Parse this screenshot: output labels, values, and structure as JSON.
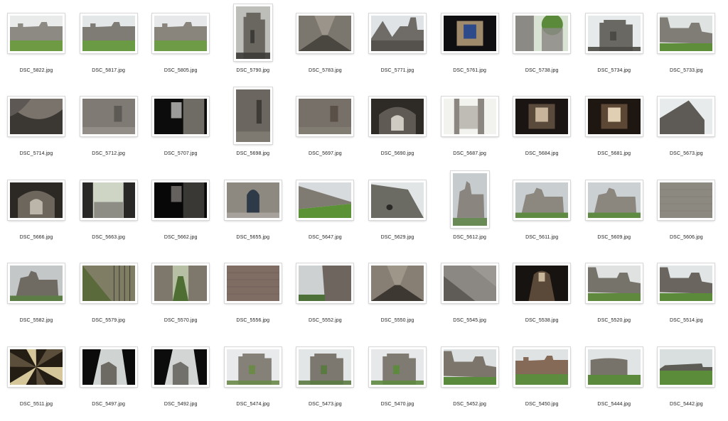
{
  "files": [
    {
      "name": "DSC_5822.jpg",
      "orientation": "landscape",
      "scene": "castle-lawn",
      "colors": {
        "sky": "#e9ebea",
        "stone": "#8d8a83",
        "ground": "#6d9a43"
      }
    },
    {
      "name": "DSC_5817.jpg",
      "orientation": "landscape",
      "scene": "castle-lawn",
      "colors": {
        "sky": "#e4e7e8",
        "stone": "#7f7c75",
        "ground": "#6b9a45"
      }
    },
    {
      "name": "DSC_5805.jpg",
      "orientation": "landscape",
      "scene": "castle-lawn",
      "colors": {
        "sky": "#e6e8ea",
        "stone": "#8a857c",
        "ground": "#6e9c46"
      }
    },
    {
      "name": "DSC_5790.jpg",
      "orientation": "portrait",
      "scene": "tower",
      "colors": {
        "sky": "#bdbdb9",
        "stone": "#6a6760",
        "ground": "#3d3b37"
      }
    },
    {
      "name": "DSC_5783.jpg",
      "orientation": "landscape",
      "scene": "passage",
      "colors": {
        "sky": "#9a948b",
        "stone": "#7b766e",
        "ground": "#4a4640"
      }
    },
    {
      "name": "DSC_5771.jpg",
      "orientation": "landscape",
      "scene": "roofs",
      "colors": {
        "sky": "#dfe3e5",
        "stone": "#6f6c67",
        "ground": "#55524d"
      }
    },
    {
      "name": "DSC_5761.jpg",
      "orientation": "landscape",
      "scene": "dark-room",
      "colors": {
        "sky": "#2d4a8a",
        "stone": "#a08a6c",
        "ground": "#0f0f12"
      }
    },
    {
      "name": "DSC_5738.jpg",
      "orientation": "landscape",
      "scene": "wall-trees",
      "colors": {
        "sky": "#d9e3d4",
        "stone": "#8c8a85",
        "ground": "#5b8a3a"
      }
    },
    {
      "name": "DSC_5734.jpg",
      "orientation": "landscape",
      "scene": "tower",
      "colors": {
        "sky": "#e7eaeb",
        "stone": "#6a6863",
        "ground": "#4c4a45"
      }
    },
    {
      "name": "DSC_5733.jpg",
      "orientation": "landscape",
      "scene": "ruins-green",
      "colors": {
        "sky": "#dfe3e2",
        "stone": "#807d76",
        "ground": "#5f8e3a"
      }
    },
    {
      "name": "DSC_5714.jpg",
      "orientation": "landscape",
      "scene": "spiral",
      "colors": {
        "sky": "#5d5853",
        "stone": "#7a736b",
        "ground": "#3b3834"
      }
    },
    {
      "name": "DSC_5712.jpg",
      "orientation": "landscape",
      "scene": "interior",
      "colors": {
        "sky": "#9e9b95",
        "stone": "#7f7b74",
        "ground": "#5d5a55"
      }
    },
    {
      "name": "DSC_5707.jpg",
      "orientation": "landscape",
      "scene": "dark-door",
      "colors": {
        "sky": "#d8d8d5",
        "stone": "#6f6c66",
        "ground": "#0c0c0c"
      }
    },
    {
      "name": "DSC_5698.jpg",
      "orientation": "portrait",
      "scene": "interior",
      "colors": {
        "sky": "#8a857d",
        "stone": "#6b665f",
        "ground": "#3e3a35"
      }
    },
    {
      "name": "DSC_5697.jpg",
      "orientation": "landscape",
      "scene": "interior",
      "colors": {
        "sky": "#8b857c",
        "stone": "#767068",
        "ground": "#5a5048"
      }
    },
    {
      "name": "DSC_5690.jpg",
      "orientation": "landscape",
      "scene": "tunnel",
      "colors": {
        "sky": "#cfcbc3",
        "stone": "#5f5a53",
        "ground": "#2e2b27"
      }
    },
    {
      "name": "DSC_5687.jpg",
      "orientation": "landscape",
      "scene": "bright-corridor",
      "colors": {
        "sky": "#f2f2ef",
        "stone": "#8b8780",
        "ground": "#a9a59d"
      }
    },
    {
      "name": "DSC_5684.jpg",
      "orientation": "landscape",
      "scene": "dark-room",
      "colors": {
        "sky": "#c7b49a",
        "stone": "#5a4a3c",
        "ground": "#1a1512"
      }
    },
    {
      "name": "DSC_5681.jpg",
      "orientation": "landscape",
      "scene": "dark-room",
      "colors": {
        "sky": "#e0cfb3",
        "stone": "#5c4735",
        "ground": "#1e1611"
      }
    },
    {
      "name": "DSC_5673.jpg",
      "orientation": "landscape",
      "scene": "gable",
      "colors": {
        "sky": "#e8ebec",
        "stone": "#5e5b56",
        "ground": "#4d4a45"
      }
    },
    {
      "name": "DSC_5666.jpg",
      "orientation": "landscape",
      "scene": "tunnel",
      "colors": {
        "sky": "#bcb6aa",
        "stone": "#6d665d",
        "ground": "#2c2925"
      }
    },
    {
      "name": "DSC_5663.jpg",
      "orientation": "landscape",
      "scene": "courtyard",
      "colors": {
        "sky": "#cfd5c5",
        "stone": "#7d7a74",
        "ground": "#2a2826"
      }
    },
    {
      "name": "DSC_5662.jpg",
      "orientation": "landscape",
      "scene": "dark-door",
      "colors": {
        "sky": "#8b8884",
        "stone": "#3a3835",
        "ground": "#080808"
      }
    },
    {
      "name": "DSC_5655.jpg",
      "orientation": "landscape",
      "scene": "arched-door",
      "colors": {
        "sky": "#a7a39c",
        "stone": "#8d8880",
        "ground": "#2f3a48"
      }
    },
    {
      "name": "DSC_5647.jpg",
      "orientation": "landscape",
      "scene": "long-wall",
      "colors": {
        "sky": "#d7dbdd",
        "stone": "#7f7a72",
        "ground": "#5c9236"
      }
    },
    {
      "name": "DSC_5629.jpg",
      "orientation": "landscape",
      "scene": "rock-wall",
      "colors": {
        "sky": "#e2e5e6",
        "stone": "#6b6a63",
        "ground": "#4e5a3c"
      }
    },
    {
      "name": "DSC_5612.jpg",
      "orientation": "portrait",
      "scene": "foggy-ruin",
      "colors": {
        "sky": "#c6cbcd",
        "stone": "#8a857e",
        "ground": "#6a8a55"
      }
    },
    {
      "name": "DSC_5611.jpg",
      "orientation": "landscape",
      "scene": "foggy-ruin",
      "colors": {
        "sky": "#c9ced1",
        "stone": "#8c877f",
        "ground": "#5f8a42"
      }
    },
    {
      "name": "DSC_5609.jpg",
      "orientation": "landscape",
      "scene": "foggy-ruin",
      "colors": {
        "sky": "#cbd0d3",
        "stone": "#8b867e",
        "ground": "#5f8a42"
      }
    },
    {
      "name": "DSC_5606.jpg",
      "orientation": "landscape",
      "scene": "stone-wall",
      "colors": {
        "sky": "#9a9790",
        "stone": "#8a877f",
        "ground": "#7b776f"
      }
    },
    {
      "name": "DSC_5582.jpg",
      "orientation": "landscape",
      "scene": "foggy-ruin",
      "colors": {
        "sky": "#c3c7c8",
        "stone": "#6f6a62",
        "ground": "#5c7d45"
      }
    },
    {
      "name": "DSC_5579.jpg",
      "orientation": "landscape",
      "scene": "stairs-moss",
      "colors": {
        "sky": "#a8a796",
        "stone": "#7f7d63",
        "ground": "#5b6a3a"
      }
    },
    {
      "name": "DSC_5570.jpg",
      "orientation": "landscape",
      "scene": "green-passage",
      "colors": {
        "sky": "#b7bfa4",
        "stone": "#7e776c",
        "ground": "#4e6e34"
      }
    },
    {
      "name": "DSC_5556.jpg",
      "orientation": "landscape",
      "scene": "stone-wall",
      "colors": {
        "sky": "#8d7b70",
        "stone": "#7d6a60",
        "ground": "#6b5a52"
      }
    },
    {
      "name": "DSC_5552.jpg",
      "orientation": "landscape",
      "scene": "wall-fog",
      "colors": {
        "sky": "#cdd1d2",
        "stone": "#6e665e",
        "ground": "#4c7038"
      }
    },
    {
      "name": "DSC_5550.jpg",
      "orientation": "landscape",
      "scene": "passage",
      "colors": {
        "sky": "#9f968a",
        "stone": "#877f74",
        "ground": "#3d3832"
      }
    },
    {
      "name": "DSC_5545.jpg",
      "orientation": "landscape",
      "scene": "stairs",
      "colors": {
        "sky": "#a7a49f",
        "stone": "#8b8883",
        "ground": "#5f5c57"
      }
    },
    {
      "name": "DSC_5538.jpg",
      "orientation": "landscape",
      "scene": "dark-tunnel",
      "colors": {
        "sky": "#c8b79a",
        "stone": "#5a4838",
        "ground": "#171310"
      }
    },
    {
      "name": "DSC_5520.jpg",
      "orientation": "landscape",
      "scene": "ruins-green",
      "colors": {
        "sky": "#dfe2e1",
        "stone": "#76736a",
        "ground": "#5f8a3e"
      }
    },
    {
      "name": "DSC_5514.jpg",
      "orientation": "landscape",
      "scene": "ruins-green",
      "colors": {
        "sky": "#e2e5e6",
        "stone": "#6a665f",
        "ground": "#5b8a3a"
      }
    },
    {
      "name": "DSC_5511.jpg",
      "orientation": "landscape",
      "scene": "spiral-up",
      "colors": {
        "sky": "#d6c79b",
        "stone": "#5b4e3b",
        "ground": "#241d14"
      }
    },
    {
      "name": "DSC_5497.jpg",
      "orientation": "landscape",
      "scene": "dark-frame",
      "colors": {
        "sky": "#cfd3d2",
        "stone": "#6d6a64",
        "ground": "#0b0b0b"
      }
    },
    {
      "name": "DSC_5492.jpg",
      "orientation": "landscape",
      "scene": "dark-frame",
      "colors": {
        "sky": "#d2d5d4",
        "stone": "#72706a",
        "ground": "#0c0c0c"
      }
    },
    {
      "name": "DSC_5474.jpg",
      "orientation": "landscape",
      "scene": "tower",
      "colors": {
        "sky": "#e8eaeb",
        "stone": "#858178",
        "ground": "#6b8a4a"
      }
    },
    {
      "name": "DSC_5473.jpg",
      "orientation": "landscape",
      "scene": "tower",
      "colors": {
        "sky": "#e3e6e7",
        "stone": "#7c776f",
        "ground": "#5b7a42"
      }
    },
    {
      "name": "DSC_5470.jpg",
      "orientation": "landscape",
      "scene": "tower",
      "colors": {
        "sky": "#e6e8e9",
        "stone": "#807b72",
        "ground": "#5e8a40"
      }
    },
    {
      "name": "DSC_5452.jpg",
      "orientation": "landscape",
      "scene": "ruins-green",
      "colors": {
        "sky": "#dde0e0",
        "stone": "#7c756c",
        "ground": "#5a8a3c"
      }
    },
    {
      "name": "DSC_5450.jpg",
      "orientation": "landscape",
      "scene": "castle-lawn",
      "colors": {
        "sky": "#e0e3e3",
        "stone": "#866a58",
        "ground": "#5e8c3e"
      }
    },
    {
      "name": "DSC_5444.jpg",
      "orientation": "landscape",
      "scene": "round-tower",
      "colors": {
        "sky": "#e1e4e4",
        "stone": "#77736a",
        "ground": "#5c8a3c"
      }
    },
    {
      "name": "DSC_5442.jpg",
      "orientation": "landscape",
      "scene": "distant-wall",
      "colors": {
        "sky": "#d9dedf",
        "stone": "#5d5c55",
        "ground": "#5b8c3a"
      }
    }
  ]
}
